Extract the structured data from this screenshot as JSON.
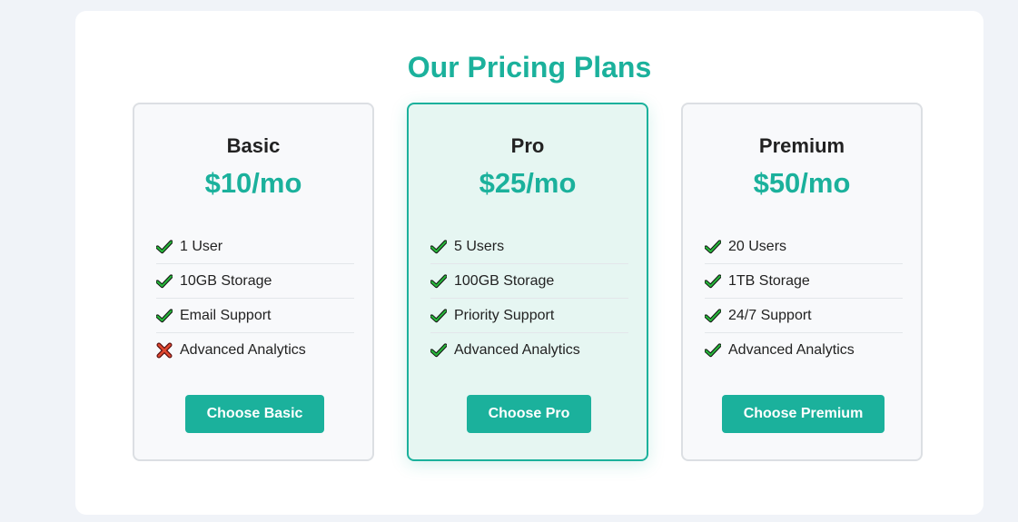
{
  "page": {
    "title": "Our Pricing Plans",
    "accent_color": "#1bb19c"
  },
  "plans": [
    {
      "name": "Basic",
      "price": "$10/mo",
      "highlighted": false,
      "features": [
        {
          "label": "1 User",
          "included": true,
          "icon": "check-icon"
        },
        {
          "label": "10GB Storage",
          "included": true,
          "icon": "check-icon"
        },
        {
          "label": "Email Support",
          "included": true,
          "icon": "check-icon"
        },
        {
          "label": "Advanced Analytics",
          "included": false,
          "icon": "cross-icon"
        }
      ],
      "button_label": "Choose Basic"
    },
    {
      "name": "Pro",
      "price": "$25/mo",
      "highlighted": true,
      "features": [
        {
          "label": "5 Users",
          "included": true,
          "icon": "check-icon"
        },
        {
          "label": "100GB Storage",
          "included": true,
          "icon": "check-icon"
        },
        {
          "label": "Priority Support",
          "included": true,
          "icon": "check-icon"
        },
        {
          "label": "Advanced Analytics",
          "included": true,
          "icon": "check-icon"
        }
      ],
      "button_label": "Choose Pro"
    },
    {
      "name": "Premium",
      "price": "$50/mo",
      "highlighted": false,
      "features": [
        {
          "label": "20 Users",
          "included": true,
          "icon": "check-icon"
        },
        {
          "label": "1TB Storage",
          "included": true,
          "icon": "check-icon"
        },
        {
          "label": "24/7 Support",
          "included": true,
          "icon": "check-icon"
        },
        {
          "label": "Advanced Analytics",
          "included": true,
          "icon": "check-icon"
        }
      ],
      "button_label": "Choose Premium"
    }
  ]
}
